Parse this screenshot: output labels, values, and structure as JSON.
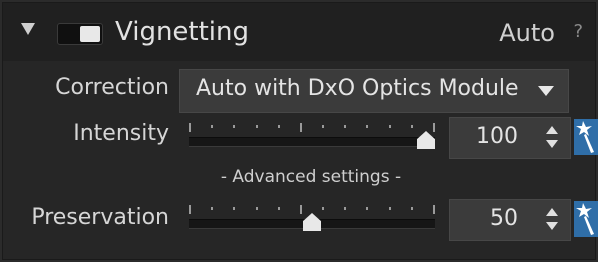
{
  "section": {
    "title": "Vignetting",
    "mode": "Auto",
    "help": "?"
  },
  "correction": {
    "label": "Correction",
    "value": "Auto with DxO Optics Module"
  },
  "intensity": {
    "label": "Intensity",
    "value": "100",
    "level_percent": 100
  },
  "advanced": {
    "label": "- Advanced settings -"
  },
  "preservation": {
    "label": "Preservation",
    "value": "50",
    "level_percent": 50
  },
  "colors": {
    "accent": "#2f6ea8",
    "panel": "#262626",
    "header": "#202020"
  },
  "icons": [
    "collapse-triangle-icon",
    "toggle-icon",
    "help-icon",
    "dropdown-arrow-icon",
    "spin-up-icon",
    "spin-down-icon",
    "magic-wand-icon"
  ]
}
